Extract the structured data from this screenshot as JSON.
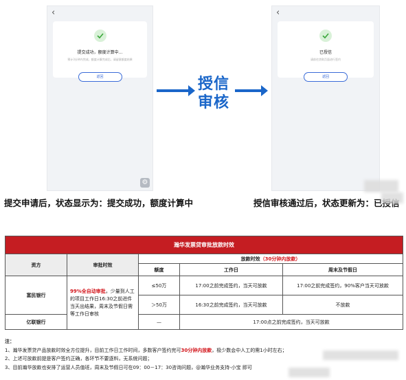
{
  "flow": {
    "left_phone": {
      "title": "提交成功，额度计算中...",
      "desc": "预计3分钟内完成，额度计算完成后，请留意额度结果",
      "button": "返回"
    },
    "right_phone": {
      "title": "已授信",
      "desc": "请前往贷款页面进行签约",
      "button": "返回"
    },
    "center_label": "授信审核",
    "caption_left": "提交申请后，状态显示为：提交成功，额度计算中",
    "caption_right": "授信审核通过后，状态更新为：已授信"
  },
  "table": {
    "title": "瀚华发票贷审批放款时效",
    "headers": {
      "party": "资方",
      "approval": "审批时效",
      "loan_timing": "放款时效",
      "loan_timing_note": "（30分钟内放款）",
      "amount": "额度",
      "workday": "工作日",
      "weekend": "周末及节假日"
    },
    "rows": {
      "bank1": "富民银行",
      "bank2": "亿联银行",
      "approval_highlight": "99%全自动审批",
      "approval_rest": "，少量到人工的项目工作日16:30之前进件当天出结果，周末及节假日需等工作日审核",
      "r1_amount": "≤50万",
      "r1_workday": "17:00之前完成签约，当天可放款",
      "r1_weekend": "17:00之前完成签约，90%客户当天可放款",
      "r2_amount": "＞50万",
      "r2_workday": "16:30之前完成签约，当天可放款",
      "r2_weekend": "不放款",
      "r3_amount": "—",
      "r3_merged": "17:00点之前完成签约，当天可放款"
    }
  },
  "notes": {
    "title": "注：",
    "n1_a": "1、瀚华发票贷产品放款时效全方位提升，目前工作日工作时间，多数客户签约完可",
    "n1_highlight": "30分钟内放款",
    "n1_b": "，极少数会中人工的需1小时左右；",
    "n2": "2、上述可放款前提是客户签约正确，各环节不要逐料，无系统问题；",
    "n3": "3、目前瀚华放款也安排了运营人员值班，周末及节假日可在09：00－17：30咨询问题，@瀚华业务支持-小宝 即可"
  },
  "colors": {
    "accent_blue": "#1a66c9",
    "header_red": "#c51d22",
    "highlight_red": "#d2141a"
  }
}
